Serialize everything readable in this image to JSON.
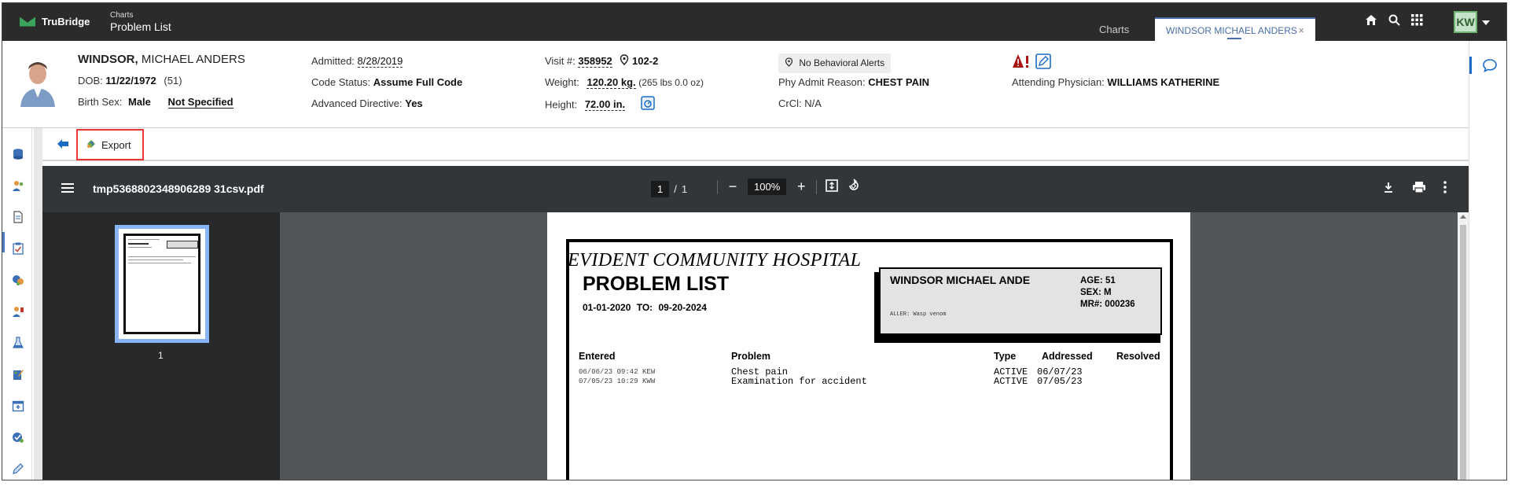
{
  "app": {
    "brand": "TruBridge",
    "breadcrumb_parent": "Charts",
    "breadcrumb_current": "Problem List",
    "tab_charts": "Charts",
    "tab_patient": "WINDSOR MICHAEL ANDERS",
    "tab_close": "×",
    "user_initials": "KW"
  },
  "patient": {
    "last_name": "WINDSOR,",
    "first_names": "MICHAEL ANDERS",
    "dob_label": "DOB:",
    "dob": "11/22/1972",
    "age": "(51)",
    "birth_sex_label": "Birth Sex:",
    "birth_sex": "Male",
    "gender": "Not Specified",
    "admitted_label": "Admitted:",
    "admitted": "8/28/2019",
    "code_status_label": "Code Status:",
    "code_status": "Assume Full Code",
    "adv_directive_label": "Advanced Directive:",
    "adv_directive": "Yes",
    "visit_label": "Visit #:",
    "visit": "358952",
    "room": "102-2",
    "weight_label": "Weight:",
    "weight": "120.20 kg.",
    "weight_lbs": "(265 lbs 0.0 oz)",
    "height_label": "Height:",
    "height": "72.00 in.",
    "behavioral": "No Behavioral Alerts",
    "admit_reason_label": "Phy Admit Reason:",
    "admit_reason": "CHEST PAIN",
    "crcl_label": "CrCl:",
    "crcl": "N/A",
    "attending_label": "Attending Physician:",
    "attending": "WILLIAMS KATHERINE"
  },
  "toolbar": {
    "export_label": "Export"
  },
  "pdf": {
    "filename": "tmp5368802348906289 31csv.pdf",
    "page_current": "1",
    "page_sep": "/",
    "page_total": "1",
    "zoom": "100%",
    "zoom_minus": "−",
    "zoom_plus": "+",
    "thumb_number": "1"
  },
  "report": {
    "hospital": "EVIDENT COMMUNITY HOSPITAL",
    "title": "PROBLEM LIST",
    "date_range": "01-01-2020   TO:   09-20-2024",
    "patient_name": "WINDSOR MICHAEL ANDE",
    "age_line": "AGE:   51",
    "sex_line": "SEX:  M",
    "mr_line": "MR#: 000236",
    "allergy_line": "ALLER:   Wasp venom",
    "headers": [
      "Entered",
      "Problem",
      "Type",
      "Addressed",
      "Resolved"
    ],
    "rows": [
      {
        "entered": "06/06/23 09:42 KEW",
        "problem": "Chest pain",
        "type": "ACTIVE",
        "addressed": "06/07/23"
      },
      {
        "entered": "07/05/23 10:29 KWW",
        "problem": "Examination for accident",
        "type": "ACTIVE",
        "addressed": "07/05/23"
      }
    ]
  },
  "colors": {
    "topbar": "#2b2b2b",
    "accent": "#4a6ea9",
    "export_highlight": "#e33333",
    "pdf_toolbar": "#323639"
  }
}
